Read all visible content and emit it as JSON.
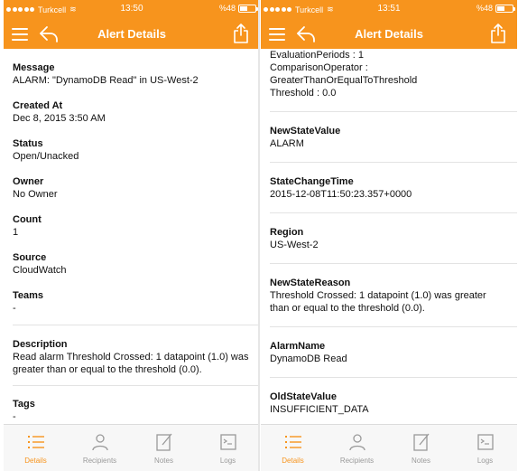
{
  "left": {
    "status": {
      "carrier": "Turkcell",
      "time": "13:50",
      "battery": "%48",
      "battery_level": 0.48
    },
    "nav": {
      "title": "Alert Details"
    },
    "fields": [
      {
        "label": "Message",
        "value": "ALARM: \"DynamoDB Read\" in US-West-2"
      },
      {
        "label": "Created At",
        "value": "Dec 8, 2015 3:50 AM"
      },
      {
        "label": "Status",
        "value": "Open/Unacked"
      },
      {
        "label": "Owner",
        "value": "No Owner"
      },
      {
        "label": "Count",
        "value": "1"
      },
      {
        "label": "Source",
        "value": "CloudWatch"
      },
      {
        "label": "Teams",
        "value": "-"
      },
      {
        "label": "Description",
        "value": "Read alarm Threshold Crossed: 1 datapoint (1.0) was greater than or equal to the threshold (0.0)."
      },
      {
        "label": "Tags",
        "value": "-"
      }
    ],
    "tabs": [
      {
        "label": "Details",
        "icon": "list-icon",
        "active": true
      },
      {
        "label": "Recipients",
        "icon": "person-icon",
        "active": false
      },
      {
        "label": "Notes",
        "icon": "note-icon",
        "active": false
      },
      {
        "label": "Logs",
        "icon": "logs-icon",
        "active": false
      }
    ]
  },
  "right": {
    "status": {
      "carrier": "Turkcell",
      "time": "13:51",
      "battery": "%48",
      "battery_level": 0.48
    },
    "nav": {
      "title": "Alert Details"
    },
    "top_lines": [
      "EvaluationPeriods : 1",
      "ComparisonOperator : GreaterThanOrEqualToThreshold",
      "Threshold : 0.0"
    ],
    "fields": [
      {
        "label": "NewStateValue",
        "value": "ALARM"
      },
      {
        "label": "StateChangeTime",
        "value": "2015-12-08T11:50:23.357+0000"
      },
      {
        "label": "Region",
        "value": "US-West-2"
      },
      {
        "label": "NewStateReason",
        "value": "Threshold Crossed: 1 datapoint (1.0) was greater than or equal to the threshold (0.0)."
      },
      {
        "label": "AlarmName",
        "value": "DynamoDB Read"
      },
      {
        "label": "OldStateValue",
        "value": "INSUFFICIENT_DATA"
      }
    ],
    "tabs": [
      {
        "label": "Details",
        "icon": "list-icon",
        "active": true
      },
      {
        "label": "Recipients",
        "icon": "person-icon",
        "active": false
      },
      {
        "label": "Notes",
        "icon": "note-icon",
        "active": false
      },
      {
        "label": "Logs",
        "icon": "logs-icon",
        "active": false
      }
    ]
  },
  "colors": {
    "accent": "#f7941d",
    "tab_inactive": "#9a9a9a",
    "separator": "#e3e3e3"
  }
}
